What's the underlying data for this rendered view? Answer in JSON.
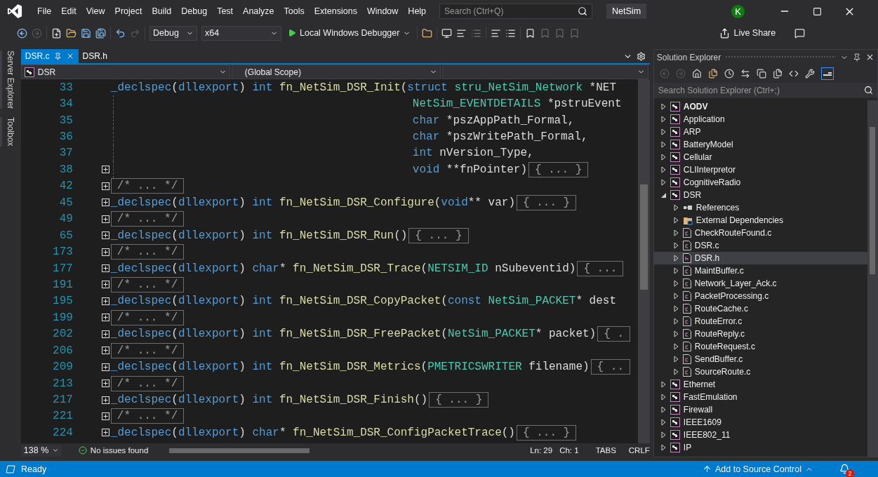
{
  "title_bar": {
    "menus": [
      "File",
      "Edit",
      "View",
      "Project",
      "Build",
      "Debug",
      "Test",
      "Analyze",
      "Tools",
      "Extensions",
      "Window",
      "Help"
    ],
    "search_placeholder": "Search (Ctrl+Q)",
    "solution_name": "NetSim",
    "account_initial": "K"
  },
  "toolbar": {
    "configuration": "Debug",
    "platform": "x64",
    "debugger": "Local Windows Debugger",
    "live_share": "Live Share"
  },
  "side_tabs": [
    "Server Explorer",
    "Toolbox"
  ],
  "editor": {
    "tabs": [
      {
        "label": "DSR.c",
        "selected": true
      },
      {
        "label": "DSR.h",
        "selected": false
      }
    ],
    "nav": {
      "project": "DSR",
      "scope": "(Global Scope)"
    },
    "lines": [
      {
        "number": "33",
        "collapsed": false,
        "continuation": false,
        "tokens": [
          {
            "kind": "keyword",
            "text": "_declspec"
          },
          {
            "kind": "text",
            "text": "("
          },
          {
            "kind": "keyword",
            "text": "dllexport"
          },
          {
            "kind": "text",
            "text": ") "
          },
          {
            "kind": "keyword",
            "text": "int "
          },
          {
            "kind": "function",
            "text": "fn_NetSim_DSR_Init"
          },
          {
            "kind": "text",
            "text": "("
          },
          {
            "kind": "keyword",
            "text": "struct "
          },
          {
            "kind": "type",
            "text": "stru_NetSim_Network"
          },
          {
            "kind": "text",
            "text": " *NET"
          }
        ]
      },
      {
        "number": "34",
        "collapsed": false,
        "continuation": true,
        "tokens": [
          {
            "kind": "type",
            "text": "NetSim_EVENTDETAILS"
          },
          {
            "kind": "text",
            "text": " *pstruEvent"
          }
        ]
      },
      {
        "number": "35",
        "collapsed": false,
        "continuation": true,
        "tokens": [
          {
            "kind": "keyword",
            "text": "char"
          },
          {
            "kind": "text",
            "text": " *pszAppPath_Formal,"
          }
        ]
      },
      {
        "number": "36",
        "collapsed": false,
        "continuation": true,
        "tokens": [
          {
            "kind": "keyword",
            "text": "char"
          },
          {
            "kind": "text",
            "text": " *pszWritePath_Formal,"
          }
        ]
      },
      {
        "number": "37",
        "collapsed": false,
        "continuation": true,
        "tokens": [
          {
            "kind": "keyword",
            "text": "int"
          },
          {
            "kind": "text",
            "text": " nVersion_Type,"
          }
        ]
      },
      {
        "number": "38",
        "collapsed": true,
        "continuation": true,
        "tokens": [
          {
            "kind": "keyword",
            "text": "void"
          },
          {
            "kind": "text",
            "text": " **fnPointer)"
          }
        ],
        "folded": "{ ... }"
      },
      {
        "number": "42",
        "collapsed": true,
        "continuation": false,
        "folded": "/* ... */"
      },
      {
        "number": "45",
        "collapsed": true,
        "continuation": false,
        "tokens": [
          {
            "kind": "keyword",
            "text": "_declspec"
          },
          {
            "kind": "text",
            "text": "("
          },
          {
            "kind": "keyword",
            "text": "dllexport"
          },
          {
            "kind": "text",
            "text": ") "
          },
          {
            "kind": "keyword",
            "text": "int "
          },
          {
            "kind": "function",
            "text": "fn_NetSim_DSR_Configure"
          },
          {
            "kind": "text",
            "text": "("
          },
          {
            "kind": "keyword",
            "text": "void"
          },
          {
            "kind": "text",
            "text": "** var)"
          }
        ],
        "folded": "{ ... }"
      },
      {
        "number": "49",
        "collapsed": true,
        "continuation": false,
        "folded": "/* ... */"
      },
      {
        "number": "65",
        "collapsed": true,
        "continuation": false,
        "tokens": [
          {
            "kind": "keyword",
            "text": "_declspec"
          },
          {
            "kind": "text",
            "text": "("
          },
          {
            "kind": "keyword",
            "text": "dllexport"
          },
          {
            "kind": "text",
            "text": ") "
          },
          {
            "kind": "keyword",
            "text": "int "
          },
          {
            "kind": "function",
            "text": "fn_NetSim_DSR_Run"
          },
          {
            "kind": "text",
            "text": "()"
          }
        ],
        "folded": "{ ... }"
      },
      {
        "number": "173",
        "collapsed": true,
        "continuation": false,
        "folded": "/* ... */"
      },
      {
        "number": "177",
        "collapsed": true,
        "continuation": false,
        "tokens": [
          {
            "kind": "keyword",
            "text": "_declspec"
          },
          {
            "kind": "text",
            "text": "("
          },
          {
            "kind": "keyword",
            "text": "dllexport"
          },
          {
            "kind": "text",
            "text": ") "
          },
          {
            "kind": "keyword",
            "text": "char"
          },
          {
            "kind": "text",
            "text": "* "
          },
          {
            "kind": "function",
            "text": "fn_NetSim_DSR_Trace"
          },
          {
            "kind": "text",
            "text": "("
          },
          {
            "kind": "type",
            "text": "NETSIM_ID"
          },
          {
            "kind": "text",
            "text": " nSubeventid)"
          }
        ],
        "folded": "{ ..."
      },
      {
        "number": "191",
        "collapsed": true,
        "continuation": false,
        "folded": "/* ... */"
      },
      {
        "number": "195",
        "collapsed": true,
        "continuation": false,
        "tokens": [
          {
            "kind": "keyword",
            "text": "_declspec"
          },
          {
            "kind": "text",
            "text": "("
          },
          {
            "kind": "keyword",
            "text": "dllexport"
          },
          {
            "kind": "text",
            "text": ") "
          },
          {
            "kind": "keyword",
            "text": "int "
          },
          {
            "kind": "function",
            "text": "fn_NetSim_DSR_CopyPacket"
          },
          {
            "kind": "text",
            "text": "("
          },
          {
            "kind": "keyword",
            "text": "const "
          },
          {
            "kind": "type",
            "text": "NetSim_PACKET"
          },
          {
            "kind": "text",
            "text": "* dest"
          }
        ]
      },
      {
        "number": "199",
        "collapsed": true,
        "continuation": false,
        "folded": "/* ... */"
      },
      {
        "number": "202",
        "collapsed": true,
        "continuation": false,
        "tokens": [
          {
            "kind": "keyword",
            "text": "_declspec"
          },
          {
            "kind": "text",
            "text": "("
          },
          {
            "kind": "keyword",
            "text": "dllexport"
          },
          {
            "kind": "text",
            "text": ") "
          },
          {
            "kind": "keyword",
            "text": "int "
          },
          {
            "kind": "function",
            "text": "fn_NetSim_DSR_FreePacket"
          },
          {
            "kind": "text",
            "text": "("
          },
          {
            "kind": "type",
            "text": "NetSim_PACKET"
          },
          {
            "kind": "text",
            "text": "* packet)"
          }
        ],
        "folded": "{ ."
      },
      {
        "number": "206",
        "collapsed": true,
        "continuation": false,
        "folded": "/* ... */"
      },
      {
        "number": "209",
        "collapsed": true,
        "continuation": false,
        "tokens": [
          {
            "kind": "keyword",
            "text": "_declspec"
          },
          {
            "kind": "text",
            "text": "("
          },
          {
            "kind": "keyword",
            "text": "dllexport"
          },
          {
            "kind": "text",
            "text": ") "
          },
          {
            "kind": "keyword",
            "text": "int "
          },
          {
            "kind": "function",
            "text": "fn_NetSim_DSR_Metrics"
          },
          {
            "kind": "text",
            "text": "("
          },
          {
            "kind": "type",
            "text": "PMETRICSWRITER"
          },
          {
            "kind": "text",
            "text": " filename)"
          }
        ],
        "folded": "{ .."
      },
      {
        "number": "213",
        "collapsed": true,
        "continuation": false,
        "folded": "/* ... */"
      },
      {
        "number": "217",
        "collapsed": true,
        "continuation": false,
        "tokens": [
          {
            "kind": "keyword",
            "text": "_declspec"
          },
          {
            "kind": "text",
            "text": "("
          },
          {
            "kind": "keyword",
            "text": "dllexport"
          },
          {
            "kind": "text",
            "text": ") "
          },
          {
            "kind": "keyword",
            "text": "int "
          },
          {
            "kind": "function",
            "text": "fn_NetSim_DSR_Finish"
          },
          {
            "kind": "text",
            "text": "()"
          }
        ],
        "folded": "{ ... }"
      },
      {
        "number": "221",
        "collapsed": true,
        "continuation": false,
        "folded": "/* ... */"
      },
      {
        "number": "224",
        "collapsed": true,
        "continuation": false,
        "tokens": [
          {
            "kind": "keyword",
            "text": "_declspec"
          },
          {
            "kind": "text",
            "text": "("
          },
          {
            "kind": "keyword",
            "text": "dllexport"
          },
          {
            "kind": "text",
            "text": ") "
          },
          {
            "kind": "keyword",
            "text": "char"
          },
          {
            "kind": "text",
            "text": "* "
          },
          {
            "kind": "function",
            "text": "fn_NetSim_DSR_ConfigPacketTrace"
          },
          {
            "kind": "text",
            "text": "()"
          }
        ],
        "folded": "{ ... }"
      }
    ],
    "status": {
      "zoom": "138 %",
      "issues": "No issues found",
      "line": "Ln: 29",
      "column": "Ch: 1",
      "indent": "TABS",
      "line_endings": "CRLF"
    }
  },
  "solution_explorer": {
    "title": "Solution Explorer",
    "search_placeholder": "Search Solution Explorer (Ctrl+;)",
    "items": [
      {
        "kind": "project",
        "label": "AODV",
        "startup": true,
        "expanded": false,
        "selected": false
      },
      {
        "kind": "project",
        "label": "Application",
        "startup": false,
        "expanded": false,
        "selected": false
      },
      {
        "kind": "project",
        "label": "ARP",
        "startup": false,
        "expanded": false,
        "selected": false
      },
      {
        "kind": "project",
        "label": "BatteryModel",
        "startup": false,
        "expanded": false,
        "selected": false
      },
      {
        "kind": "project",
        "label": "Cellular",
        "startup": false,
        "expanded": false,
        "selected": false
      },
      {
        "kind": "project",
        "label": "CLIInterpretor",
        "startup": false,
        "expanded": false,
        "selected": false
      },
      {
        "kind": "project",
        "label": "CognitiveRadio",
        "startup": false,
        "expanded": false,
        "selected": false
      },
      {
        "kind": "project",
        "label": "DSR",
        "startup": false,
        "expanded": true,
        "selected": false,
        "children": [
          {
            "kind": "references",
            "label": "References",
            "expanded": false,
            "selected": false
          },
          {
            "kind": "external",
            "label": "External Dependencies",
            "expanded": false,
            "selected": false
          },
          {
            "kind": "source",
            "label": "CheckRouteFound.c",
            "expanded": false,
            "selected": false
          },
          {
            "kind": "source",
            "label": "DSR.c",
            "expanded": false,
            "selected": false
          },
          {
            "kind": "header",
            "label": "DSR.h",
            "expanded": false,
            "selected": true
          },
          {
            "kind": "source",
            "label": "MaintBuffer.c",
            "expanded": false,
            "selected": false
          },
          {
            "kind": "source",
            "label": "Network_Layer_Ack.c",
            "expanded": false,
            "selected": false
          },
          {
            "kind": "source",
            "label": "PacketProcessing.c",
            "expanded": false,
            "selected": false
          },
          {
            "kind": "source",
            "label": "RouteCache.c",
            "expanded": false,
            "selected": false
          },
          {
            "kind": "source",
            "label": "RouteError.c",
            "expanded": false,
            "selected": false
          },
          {
            "kind": "source",
            "label": "RouteReply.c",
            "expanded": false,
            "selected": false
          },
          {
            "kind": "source",
            "label": "RouteRequest.c",
            "expanded": false,
            "selected": false
          },
          {
            "kind": "source",
            "label": "SendBuffer.c",
            "expanded": false,
            "selected": false
          },
          {
            "kind": "source",
            "label": "SourceRoute.c",
            "expanded": false,
            "selected": false
          }
        ]
      },
      {
        "kind": "project",
        "label": "Ethernet",
        "startup": false,
        "expanded": false,
        "selected": false
      },
      {
        "kind": "project",
        "label": "FastEmulation",
        "startup": false,
        "expanded": false,
        "selected": false
      },
      {
        "kind": "project",
        "label": "Firewall",
        "startup": false,
        "expanded": false,
        "selected": false
      },
      {
        "kind": "project",
        "label": "IEEE1609",
        "startup": false,
        "expanded": false,
        "selected": false
      },
      {
        "kind": "project",
        "label": "IEEE802_11",
        "startup": false,
        "expanded": false,
        "selected": false
      },
      {
        "kind": "project",
        "label": "IP",
        "startup": false,
        "expanded": false,
        "selected": false
      }
    ]
  },
  "status_bar": {
    "state": "Ready",
    "source_control": "Add to Source Control",
    "notifications": "2"
  }
}
